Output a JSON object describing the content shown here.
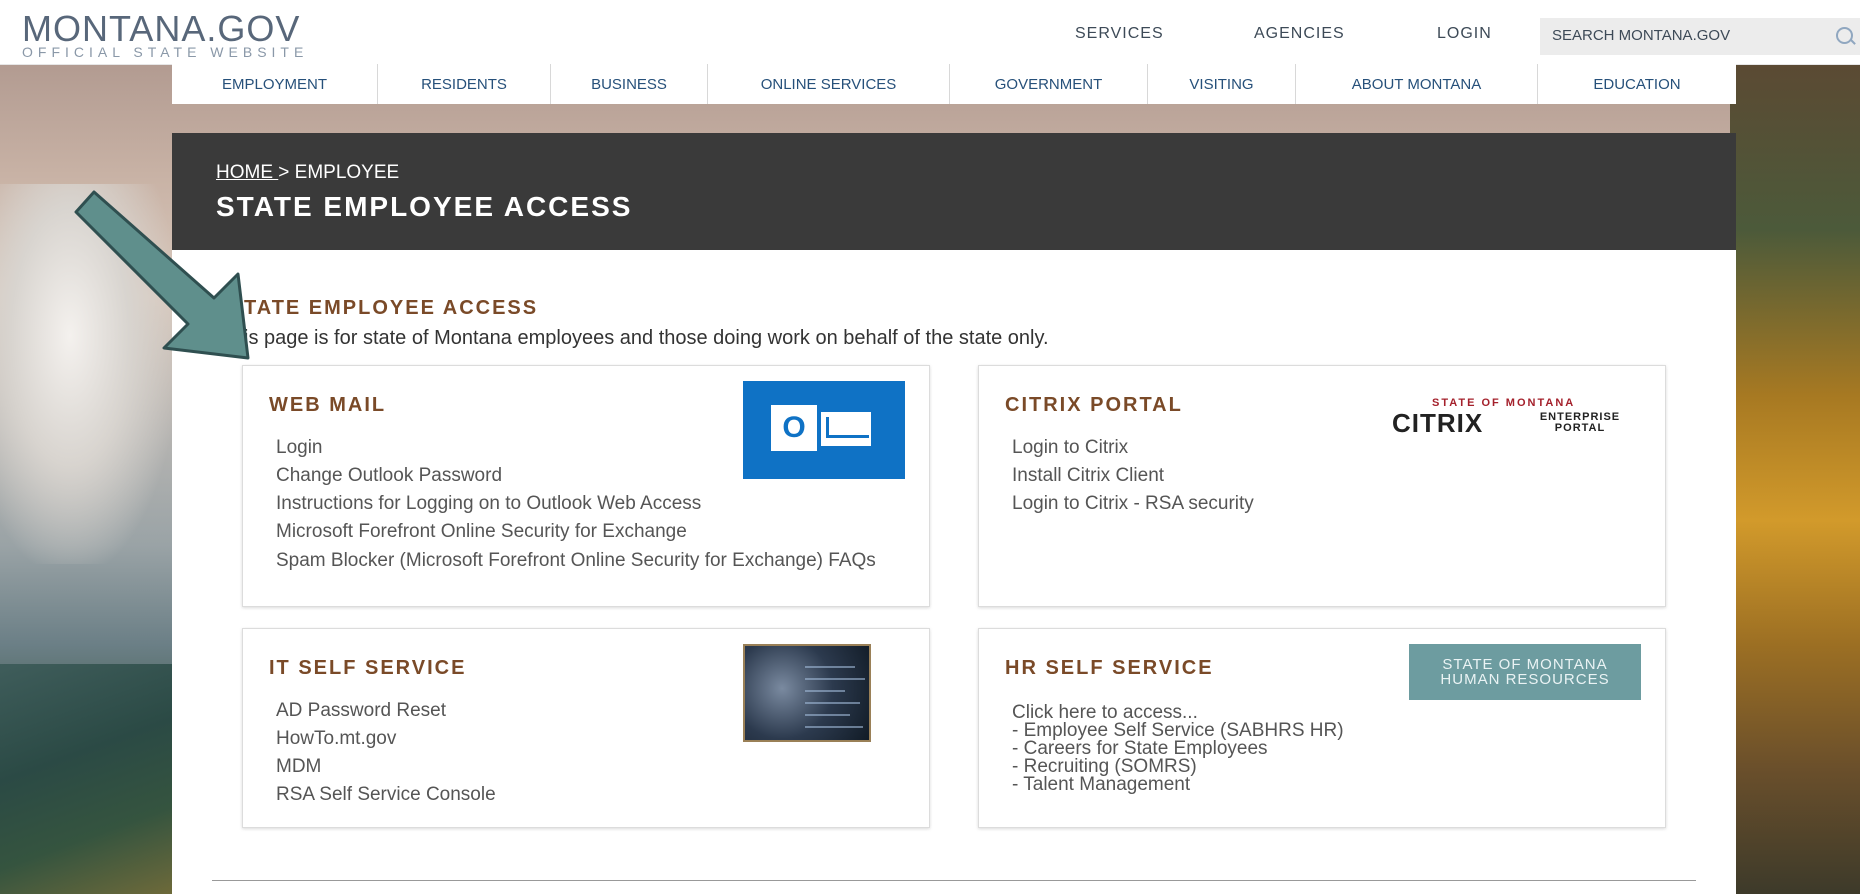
{
  "header": {
    "logo_main": "MONTANA.GOV",
    "logo_sub": "OFFICIAL STATE WEBSITE",
    "nav": [
      "SERVICES",
      "AGENCIES",
      "LOGIN"
    ],
    "search_placeholder": "SEARCH MONTANA.GOV"
  },
  "categories": [
    "EMPLOYMENT",
    "RESIDENTS",
    "BUSINESS",
    "ONLINE SERVICES",
    "GOVERNMENT",
    "VISITING",
    "ABOUT MONTANA",
    "EDUCATION"
  ],
  "breadcrumb": {
    "home": "HOME ",
    "sep": "> ",
    "current": "EMPLOYEE"
  },
  "page_title": "STATE EMPLOYEE ACCESS",
  "section": {
    "heading": "TATE EMPLOYEE ACCESS",
    "intro": "is page is for state of Montana employees and those doing work on behalf of the state only."
  },
  "cards": {
    "web_mail": {
      "title": "WEB MAIL",
      "links": [
        "Login",
        "Change Outlook Password",
        "Instructions for Logging on to Outlook Web Access",
        "Microsoft Forefront Online Security for Exchange",
        "Spam Blocker (Microsoft Forefront Online Security for Exchange) FAQs"
      ],
      "icon_letter": "O"
    },
    "citrix": {
      "title": "CITRIX PORTAL",
      "links": [
        "Login to Citrix",
        "Install Citrix Client",
        "Login to Citrix - RSA security"
      ],
      "logo_top": "STATE OF MONTANA",
      "logo_main": "CITRIX",
      "logo_side": "ENTERPRISE PORTAL"
    },
    "it_self_service": {
      "title": "IT SELF SERVICE",
      "links": [
        "AD Password Reset",
        "HowTo.mt.gov",
        "MDM",
        "RSA Self Service Console"
      ]
    },
    "hr_self_service": {
      "title": "HR SELF SERVICE",
      "lines": [
        "Click here to access...",
        "- Employee Self Service (SABHRS HR)",
        "- Careers for State Employees",
        "- Recruiting (SOMRS)",
        "- Talent Management"
      ],
      "logo_line1": "STATE OF MONTANA",
      "logo_line2": "HUMAN RESOURCES"
    }
  },
  "colors": {
    "heading": "#7a4a28",
    "nav_link": "#26507a",
    "title_bar": "#3a3a3a",
    "arrow": "#5f8f8c"
  }
}
